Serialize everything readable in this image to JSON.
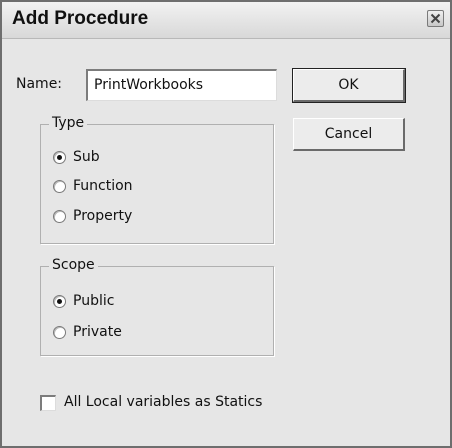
{
  "dialog": {
    "title": "Add Procedure",
    "close_icon": "close-x-icon"
  },
  "name_field": {
    "label": "Name:",
    "value": "PrintWorkbooks"
  },
  "buttons": {
    "ok": "OK",
    "cancel": "Cancel"
  },
  "type_group": {
    "legend": "Type",
    "options": [
      {
        "label": "Sub",
        "selected": true
      },
      {
        "label": "Function",
        "selected": false
      },
      {
        "label": "Property",
        "selected": false
      }
    ]
  },
  "scope_group": {
    "legend": "Scope",
    "options": [
      {
        "label": "Public",
        "selected": true
      },
      {
        "label": "Private",
        "selected": false
      }
    ]
  },
  "statics_checkbox": {
    "label": "All Local variables as Statics",
    "checked": false
  }
}
